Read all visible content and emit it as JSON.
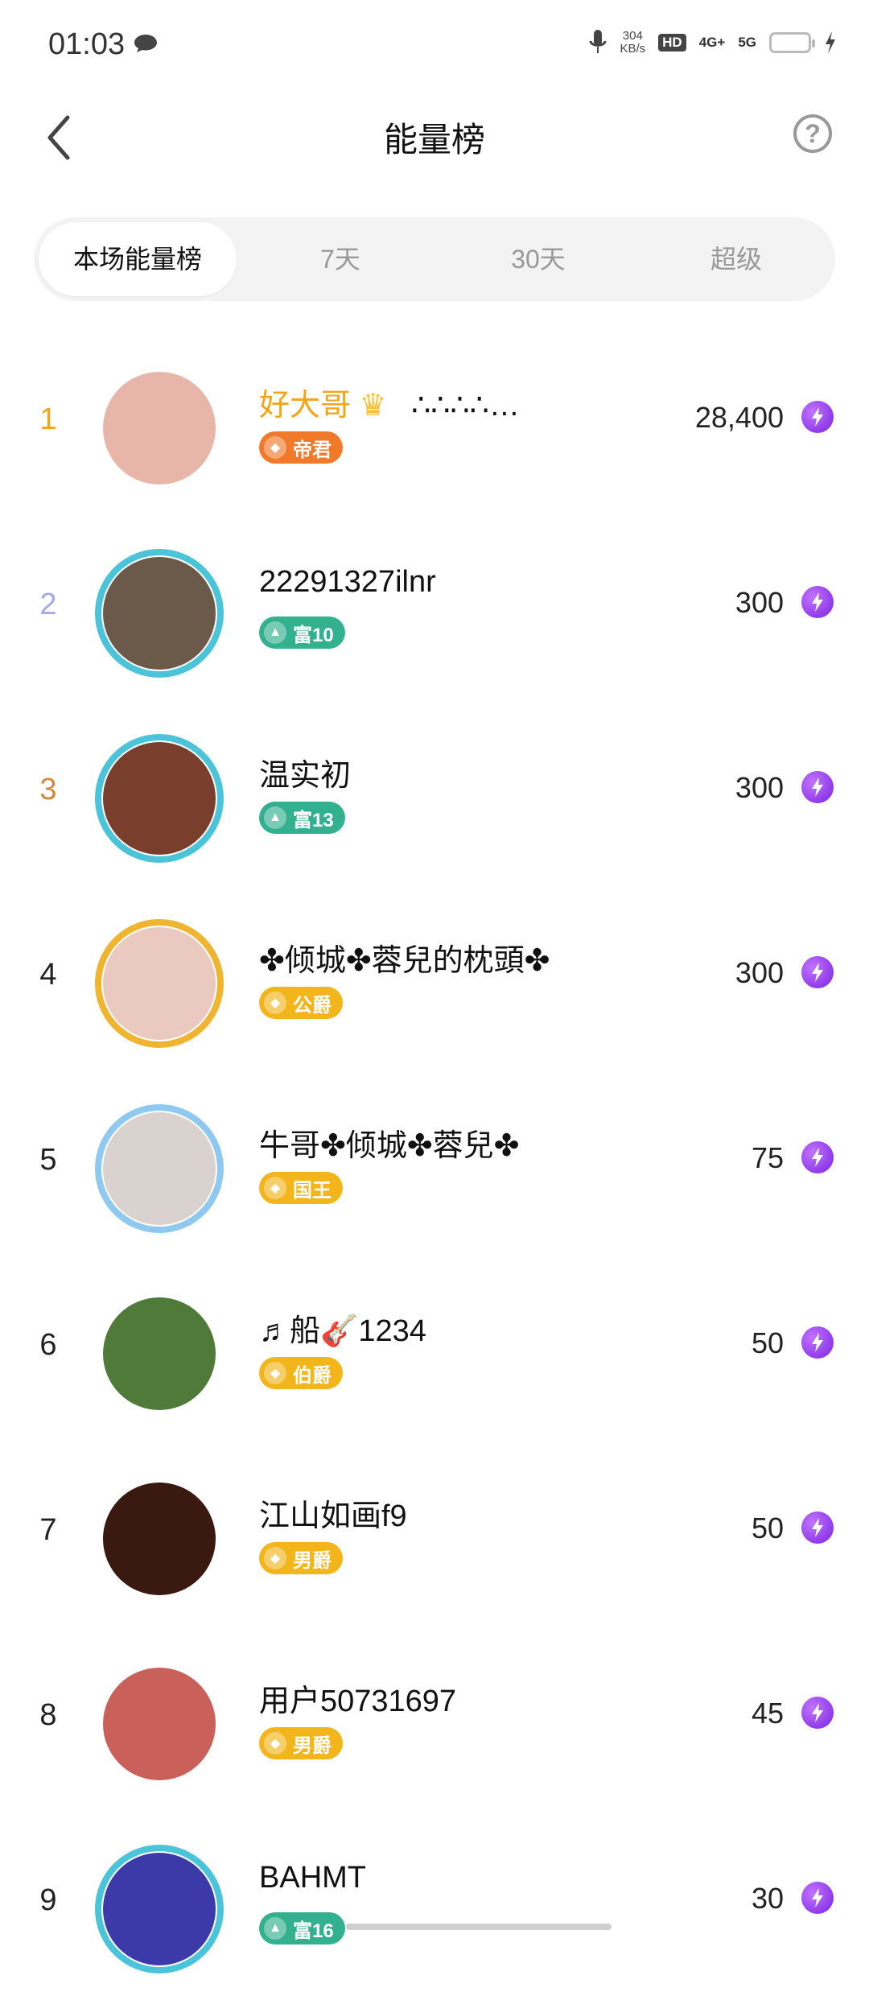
{
  "status_bar": {
    "time": "01:03",
    "net_speed_value": "304",
    "net_speed_unit": "KB/s",
    "hd": "HD",
    "net1": "4G+",
    "net2": "5G"
  },
  "header": {
    "title": "能量榜",
    "help_label": "?"
  },
  "tabs": [
    {
      "label": "本场能量榜",
      "active": true
    },
    {
      "label": "7天",
      "active": false
    },
    {
      "label": "30天",
      "active": false
    },
    {
      "label": "超级",
      "active": false
    }
  ],
  "rows": [
    {
      "rank": "1",
      "name": "好大哥",
      "extra": "∴∴∴∴…",
      "badge": "帝君",
      "badge_style": "orange",
      "score": "28,400",
      "rank_color": "#f2a516",
      "avatar": "#e7b6a8"
    },
    {
      "rank": "2",
      "name": "22291327ilnr",
      "badge": "富10",
      "badge_style": "teal",
      "score": "300",
      "rank_color": "#a7a9e6",
      "avatar": "#6b5a4a"
    },
    {
      "rank": "3",
      "name": "温实初",
      "badge": "富13",
      "badge_style": "teal",
      "score": "300",
      "rank_color": "#d08a3c",
      "avatar": "#7a3f2c"
    },
    {
      "rank": "4",
      "name": "✤倾城✤蓉兒的枕頭✤",
      "badge": "公爵",
      "badge_style": "gold",
      "score": "300",
      "rank_color": "#222222",
      "avatar": "#e9c9c0"
    },
    {
      "rank": "5",
      "name": "牛哥✤倾城✤蓉兒✤",
      "badge": "国王",
      "badge_style": "gold",
      "score": "75",
      "rank_color": "#222222",
      "avatar": "#d9d2cf"
    },
    {
      "rank": "6",
      "name": "♬船🎸1234",
      "badge": "伯爵",
      "badge_style": "gold",
      "score": "50",
      "rank_color": "#222222",
      "avatar": "#4f7a3a"
    },
    {
      "rank": "7",
      "name": "江山如画f9",
      "badge": "男爵",
      "badge_style": "gold",
      "score": "50",
      "rank_color": "#222222",
      "avatar": "#3a1a10"
    },
    {
      "rank": "8",
      "name": "用户50731697",
      "badge": "男爵",
      "badge_style": "gold",
      "score": "45",
      "rank_color": "#222222",
      "avatar": "#c9605a"
    },
    {
      "rank": "9",
      "name": "BAHMT",
      "badge": "富16",
      "badge_style": "teal",
      "score": "30",
      "rank_color": "#222222",
      "avatar": "#3c3aa8"
    }
  ],
  "colors": {
    "gold_rank": "#f2a516",
    "silver_rank": "#a7a9e6",
    "bronze_rank": "#d08a3c",
    "energy": "#8a2be2"
  }
}
